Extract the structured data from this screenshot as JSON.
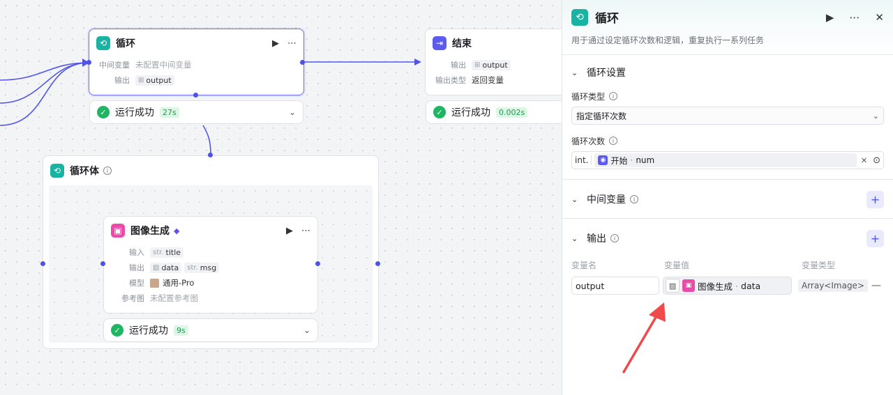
{
  "colors": {
    "accent": "#5b5bf2",
    "teal": "#17b3a3",
    "pink": "#ea4aa8",
    "success": "#1fb563",
    "annotation_arrow": "#f04a4a"
  },
  "nodes": {
    "loop": {
      "title": "循环",
      "icon": "loop-icon",
      "mid_var_label": "中间变量",
      "mid_var_value": "未配置中间变量",
      "output_label": "输出",
      "output_value": "output",
      "status": "运行成功",
      "time": "27s"
    },
    "end": {
      "title": "结束",
      "icon": "end-icon",
      "output_label": "输出",
      "output_value": "output",
      "type_label": "输出类型",
      "type_value": "返回变量",
      "status": "运行成功",
      "time": "0.002s"
    },
    "loop_body": {
      "title": "循环体"
    },
    "image_gen": {
      "title": "图像生成",
      "input_label": "输入",
      "input_prefix": "str.",
      "input_value": "title",
      "output_label": "输出",
      "output_value_1": "data",
      "output_prefix_2": "str.",
      "output_value_2": "msg",
      "model_label": "模型",
      "model_value": "通用-Pro",
      "ref_label": "参考图",
      "ref_value": "未配置参考图",
      "status": "运行成功",
      "time": "9s"
    }
  },
  "panel": {
    "title": "循环",
    "description": "用于通过设定循环次数和逻辑，重复执行一系列任务",
    "loop_settings": {
      "title": "循环设置",
      "loop_type_label": "循环类型",
      "loop_type_value": "指定循环次数",
      "loop_count_label": "循环次数",
      "loop_count_prefix": "int.",
      "loop_count_source": "开始",
      "loop_count_var": "num"
    },
    "mid_vars": {
      "title": "中间变量"
    },
    "output": {
      "title": "输出",
      "col_name": "变量名",
      "col_value": "变量值",
      "col_type": "变量类型",
      "row_name": "output",
      "row_source": "图像生成",
      "row_var": "data",
      "row_type": "Array<Image>"
    }
  }
}
